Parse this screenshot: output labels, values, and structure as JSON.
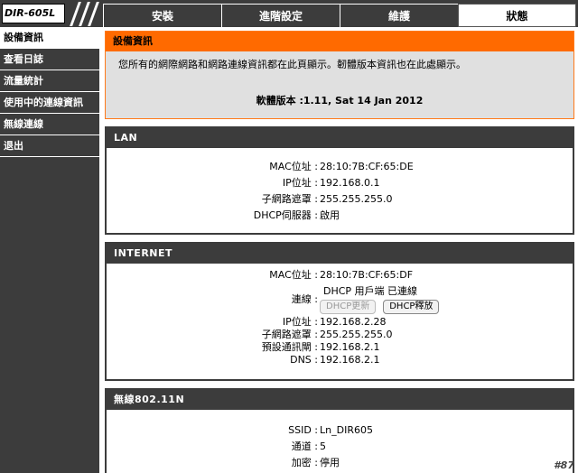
{
  "header": {
    "model": "DIR-605L",
    "tabs": [
      {
        "label": "安裝",
        "active": false
      },
      {
        "label": "進階設定",
        "active": false
      },
      {
        "label": "維護",
        "active": false
      },
      {
        "label": "狀態",
        "active": true
      }
    ]
  },
  "sidebar": {
    "items": [
      {
        "label": "設備資訊",
        "active": true
      },
      {
        "label": "查看日誌",
        "active": false
      },
      {
        "label": "流量統計",
        "active": false
      },
      {
        "label": "使用中的連線資訊",
        "active": false
      },
      {
        "label": "無線連線",
        "active": false
      },
      {
        "label": "退出",
        "active": false
      }
    ]
  },
  "device_info": {
    "title": "設備資訊",
    "description": "您所有的網際網路和網路連線資訊都在此頁顯示。韌體版本資訊也在此處顯示。",
    "firmware_line": "軟體版本 :1.11,  Sat 14 Jan 2012"
  },
  "lan": {
    "title": "LAN",
    "rows": [
      {
        "label": "MAC位址 :",
        "value": "28:10:7B:CF:65:DE"
      },
      {
        "label": "IP位址 :",
        "value": "192.168.0.1"
      },
      {
        "label": "子網路遮罩 :",
        "value": "255.255.255.0"
      },
      {
        "label": "DHCP伺服器 :",
        "value": "啟用"
      }
    ]
  },
  "internet": {
    "title": "INTERNET",
    "mac": {
      "label": "MAC位址 :",
      "value": "28:10:7B:CF:65:DF"
    },
    "connection": {
      "label": "連線 :",
      "status": "DHCP 用戶端 已連線",
      "renew_label": "DHCP更新",
      "release_label": "DHCP釋放"
    },
    "rows": [
      {
        "label": "IP位址 :",
        "value": "192.168.2.28"
      },
      {
        "label": "子網路遮罩 :",
        "value": "255.255.255.0"
      },
      {
        "label": "預設通訊閘 :",
        "value": "192.168.2.1"
      },
      {
        "label": "DNS :",
        "value": "192.168.2.1"
      }
    ]
  },
  "wireless": {
    "title": "無線802.11N",
    "rows": [
      {
        "label": "SSID :",
        "value": "Ln_DIR605"
      },
      {
        "label": "通道 :",
        "value": "5"
      },
      {
        "label": "加密 :",
        "value": "停用"
      }
    ]
  },
  "watermark": "#87",
  "colors": {
    "dark": "#3c3c3c",
    "orange": "#ff6a00",
    "info_bg": "#e0e0e0"
  }
}
